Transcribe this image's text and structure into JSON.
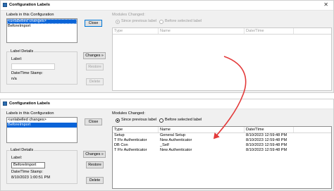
{
  "window_title": "Configuration Labels",
  "labels_in_config": "Labels in this Configuration",
  "modules_changed": "Modules Changed:",
  "label_details": "Label Details",
  "label_field": "Label:",
  "date_time_stamp": "Date/Time Stamp:",
  "radio_since": "Since previous label",
  "radio_before": "Before selected label",
  "buttons": {
    "close": "Close",
    "changes": "Changes »",
    "restore": "Restore",
    "delete": "Delete"
  },
  "columns": [
    "Type",
    "Name",
    "Date/Time"
  ],
  "top": {
    "labels": [
      "<unlabelled changes>",
      "BeforeImport"
    ],
    "selected_index": 0,
    "label_value": "",
    "date_value": "n/a",
    "since_checked": true
  },
  "bottom": {
    "labels": [
      "<unlabelled changes>",
      "BeforeImport"
    ],
    "selected_index": 1,
    "label_value": "BeforeImport",
    "date_value": "8/10/2023 1:00:51 PM",
    "since_checked": true,
    "rows": [
      {
        "type": "Setup",
        "name": "General Setup",
        "date": "8/10/2023 12:59:48 PM"
      },
      {
        "type": "T Flv Authenticator",
        "name": "New Authenticator",
        "date": "8/10/2023 12:59:48 PM"
      },
      {
        "type": "DB Con",
        "name": "_Self",
        "date": "8/10/2023 12:59:48 PM"
      },
      {
        "type": "T Flv Authenticator",
        "name": "New Authenticator",
        "date": "8/10/2023 12:59:48 PM"
      }
    ]
  },
  "colors": {
    "selection": "#0a64d8",
    "arrow": "#e33a3a",
    "window_bg": "#f0f0f0"
  }
}
